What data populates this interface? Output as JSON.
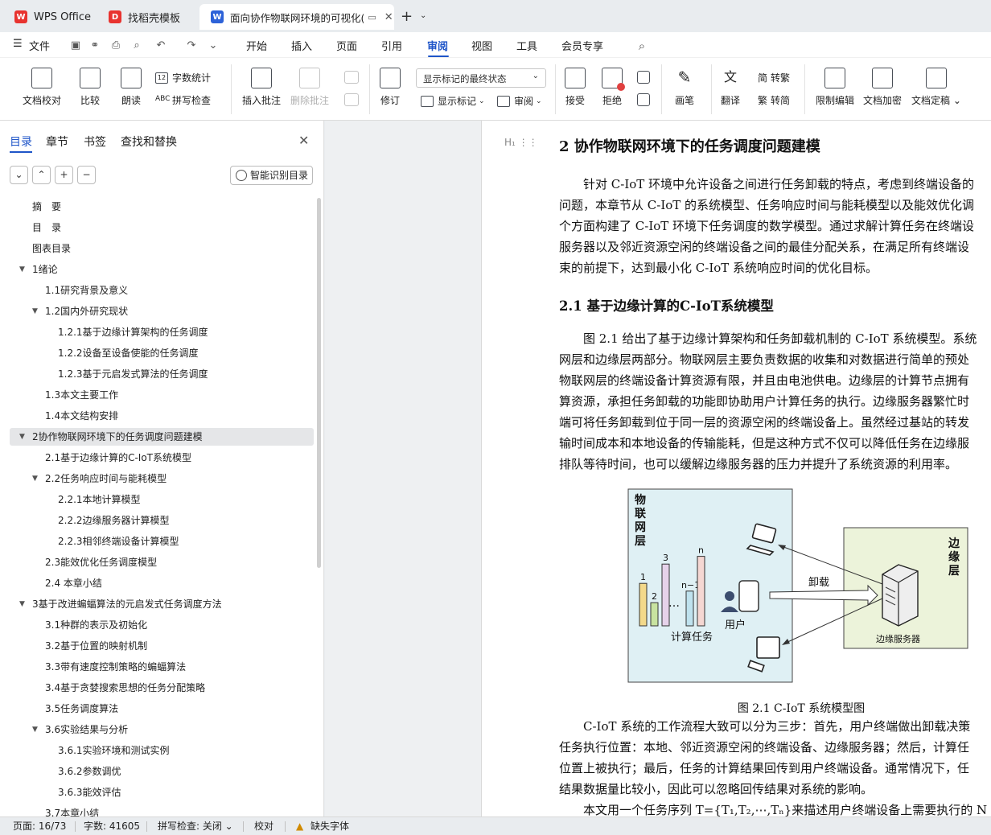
{
  "tabs": [
    {
      "label": "WPS Office",
      "icon": "wps-logo-icon"
    },
    {
      "label": "找稻壳模板",
      "icon": "docer-icon"
    },
    {
      "label": "面向协作物联网环境的可视化(",
      "icon": "writer-doc-icon"
    }
  ],
  "menu": {
    "file": "文件",
    "items": [
      "开始",
      "插入",
      "页面",
      "引用",
      "审阅",
      "视图",
      "工具",
      "会员专享"
    ],
    "active": "审阅"
  },
  "ribbon": {
    "doc_check": "文档校对",
    "compare": "比较",
    "read_aloud": "朗读",
    "word_count": "字数统计",
    "spell_check": "拼写检查",
    "insert_comment": "插入批注",
    "delete_comment": "删除批注",
    "revise": "修订",
    "markup_state": "显示标记的最终状态",
    "show_markup": "显示标记",
    "review": "审阅",
    "accept": "接受",
    "reject": "拒绝",
    "pen": "画笔",
    "translate": "翻译",
    "to_traditional": "转繁",
    "to_simplified": "转简",
    "restrict_edit": "限制编辑",
    "encrypt": "文档加密",
    "finalize": "文档定稿"
  },
  "sidebar": {
    "tabs": [
      "目录",
      "章节",
      "书签",
      "查找和替换"
    ],
    "smart_toc": "智能识别目录",
    "toc": [
      {
        "label": "摘　要",
        "level": 0
      },
      {
        "label": "目　录",
        "level": 0
      },
      {
        "label": "图表目录",
        "level": 0
      },
      {
        "label": "1绪论",
        "level": 0,
        "caret": true
      },
      {
        "label": "1.1研究背景及意义",
        "level": 1
      },
      {
        "label": "1.2国内外研究现状",
        "level": 1,
        "caret": true
      },
      {
        "label": "1.2.1基于边缘计算架构的任务调度",
        "level": 2
      },
      {
        "label": "1.2.2设备至设备使能的任务调度",
        "level": 2
      },
      {
        "label": "1.2.3基于元启发式算法的任务调度",
        "level": 2
      },
      {
        "label": "1.3本文主要工作",
        "level": 1
      },
      {
        "label": "1.4本文结构安排",
        "level": 1
      },
      {
        "label": "2协作物联网环境下的任务调度问题建模",
        "level": 0,
        "caret": true,
        "selected": true
      },
      {
        "label": "2.1基于边缘计算的C-IoT系统模型",
        "level": 1
      },
      {
        "label": "2.2任务响应时间与能耗模型",
        "level": 1,
        "caret": true
      },
      {
        "label": "2.2.1本地计算模型",
        "level": 2
      },
      {
        "label": "2.2.2边缘服务器计算模型",
        "level": 2
      },
      {
        "label": "2.2.3相邻终端设备计算模型",
        "level": 2
      },
      {
        "label": "2.3能效优化任务调度模型",
        "level": 1
      },
      {
        "label": "2.4 本章小结",
        "level": 1
      },
      {
        "label": "3基于改进蝙蝠算法的元启发式任务调度方法",
        "level": 0,
        "caret": true
      },
      {
        "label": "3.1种群的表示及初始化",
        "level": 1
      },
      {
        "label": "3.2基于位置的映射机制",
        "level": 1
      },
      {
        "label": "3.3带有速度控制策略的蝙蝠算法",
        "level": 1
      },
      {
        "label": "3.4基于贪婪搜索思想的任务分配策略",
        "level": 1
      },
      {
        "label": "3.5任务调度算法",
        "level": 1
      },
      {
        "label": "3.6实验结果与分析",
        "level": 1,
        "caret": true
      },
      {
        "label": "3.6.1实验环境和测试实例",
        "level": 2
      },
      {
        "label": "3.6.2参数调优",
        "level": 2
      },
      {
        "label": "3.6.3能效评估",
        "level": 2
      },
      {
        "label": "3.7本章小结",
        "level": 1
      }
    ]
  },
  "doc": {
    "heading_marker": "H₁",
    "h1": "2  协作物联网环境下的任务调度问题建模",
    "p1": [
      "　　针对 C-IoT 环境中允许设备之间进行任务卸载的特点，考虑到终端设备的",
      "问题，本章节从 C-IoT 的系统模型、任务响应时间与能耗模型以及能效优化调",
      "个方面构建了 C-IoT 环境下任务调度的数学模型。通过求解计算任务在终端设",
      "服务器以及邻近资源空闲的终端设备之间的最佳分配关系，在满足所有终端设",
      "束的前提下，达到最小化 C-IoT 系统响应时间的优化目标。"
    ],
    "h2": "2.1  基于边缘计算的C-IoT系统模型",
    "p2": [
      "　　图 2.1 给出了基于边缘计算架构和任务卸载机制的 C-IoT 系统模型。系统",
      "网层和边缘层两部分。物联网层主要负责数据的收集和对数据进行简单的预处",
      "物联网层的终端设备计算资源有限，并且由电池供电。边缘层的计算节点拥有",
      "算资源，承担任务卸载的功能即协助用户计算任务的执行。边缘服务器繁忙时",
      "端可将任务卸载到位于同一层的资源空闲的终端设备上。虽然经过基站的转发",
      "输时间成本和本地设备的传输能耗，但是这种方式不仅可以降低任务在边缘服",
      "排队等待时间，也可以缓解边缘服务器的压力并提升了系统资源的利用率。"
    ],
    "figure": {
      "iot_layer": "物联网层",
      "edge_layer": "边缘层",
      "tasks_label": "计算任务",
      "user_label": "用户",
      "offload_label": "卸载",
      "server_label": "边缘服务器",
      "bar_labels": [
        "1",
        "2",
        "3",
        "…",
        "n−1",
        "n"
      ],
      "task_sizes": [
        0.55,
        0.3,
        0.8,
        0.45,
        0.9
      ],
      "bar_colors": [
        "#f3d98a",
        "#c8e3a0",
        "#e6d2ea",
        "#bfe2ee",
        "#f5d7d2"
      ]
    },
    "caption": "图 2.1 C-IoT 系统模型图",
    "p3": [
      "　　C-IoT 系统的工作流程大致可以分为三步：首先，用户终端做出卸载决策",
      "任务执行位置：本地、邻近资源空闲的终端设备、边缘服务器；然后，计算任",
      "位置上被执行；最后，任务的计算结果回传到用户终端设备。通常情况下，任",
      "结果数据量比较小，因此可以忽略回传结果对系统的影响。",
      "　　本文用一个任务序列 T={T₁,T₂,⋯,Tₙ}来描述用户终端设备上需要执行的 N"
    ]
  },
  "status": {
    "page": "页面: 16/73",
    "words": "字数: 41605",
    "spell": "拼写检查: 关闭",
    "proof": "校对",
    "missing_font": "缺失字体"
  }
}
